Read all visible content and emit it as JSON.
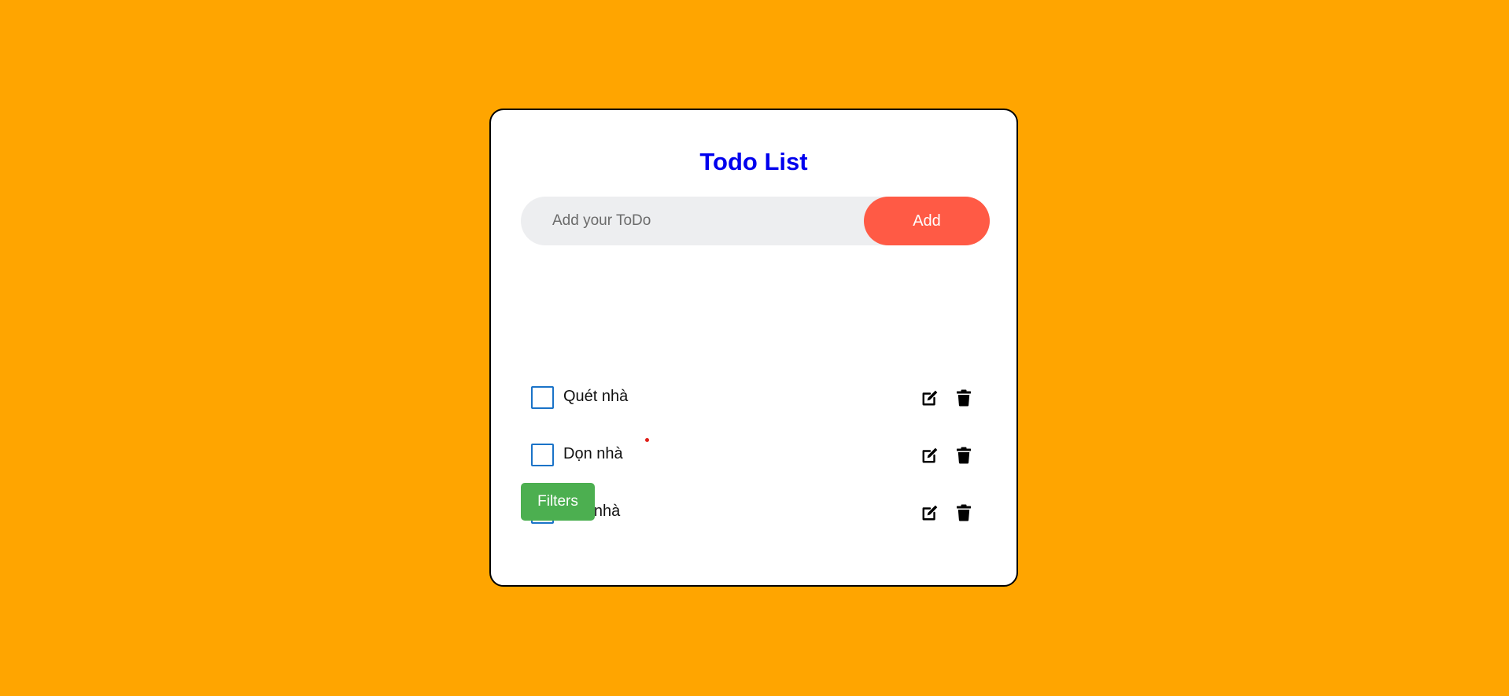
{
  "page": {
    "background_color": "#FFA500"
  },
  "app": {
    "title": "Todo List",
    "title_color": "#0000EE"
  },
  "add_form": {
    "input_value": "",
    "placeholder": "Add your ToDo",
    "add_label": "Add",
    "add_color": "#FF5A45"
  },
  "todos": [
    {
      "text": "Quét nhà",
      "completed": false
    },
    {
      "text": "Dọn nhà",
      "completed": false
    },
    {
      "text": "Lau nhà",
      "completed": false
    }
  ],
  "filters": {
    "label": "Filters",
    "color": "#4CAF50"
  },
  "icons": {
    "edit": "edit-icon",
    "delete": "trash-icon",
    "checkbox": "checkbox-icon"
  }
}
